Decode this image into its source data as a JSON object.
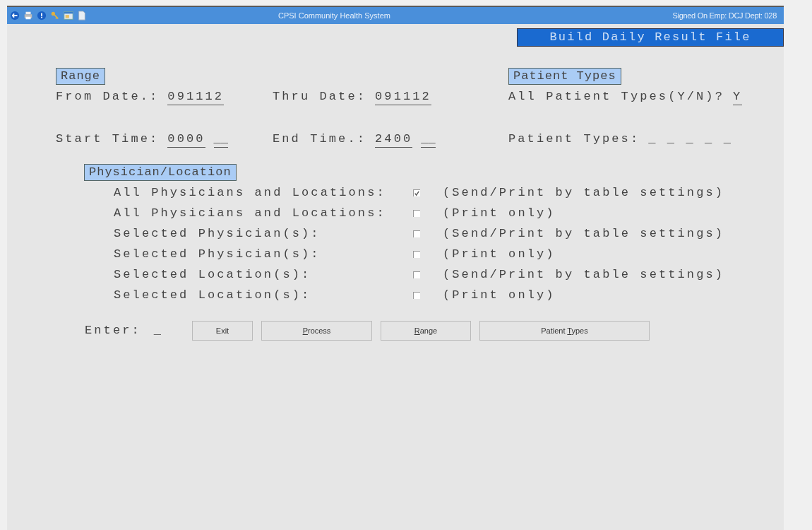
{
  "title_bar": {
    "title": "CPSI Community Health System",
    "user": "Signed On Emp: DCJ  Dept: 028"
  },
  "screen_title": "Build Daily Result File",
  "range": {
    "heading": "Range",
    "from_date": {
      "label": "From Date.:",
      "value": "091112"
    },
    "thru_date": {
      "label": "Thru Date:",
      "value": "091112"
    },
    "start_time": {
      "label": "Start Time:",
      "value": "0000",
      "suffix": "__"
    },
    "end_time": {
      "label": "End Time.:",
      "value": "2400",
      "suffix": "__"
    }
  },
  "patient_types": {
    "heading": "Patient Types",
    "all": {
      "label": "All Patient Types(Y/N)?",
      "value": "Y"
    },
    "types": {
      "label": "Patient Types:",
      "value": "_ _ _ _ _"
    }
  },
  "physician_location": {
    "heading": "Physician/Location",
    "options": [
      {
        "label": "All Physicians and Locations:",
        "checked": true,
        "description": "(Send/Print by table settings)"
      },
      {
        "label": "All Physicians and Locations:",
        "checked": false,
        "description": "(Print only)"
      },
      {
        "label": "Selected Physician(s):",
        "checked": false,
        "description": "(Send/Print by table settings)"
      },
      {
        "label": "Selected Physician(s):",
        "checked": false,
        "description": "(Print only)"
      },
      {
        "label": "Selected Location(s):",
        "checked": false,
        "description": "(Send/Print by table settings)"
      },
      {
        "label": "Selected Location(s):",
        "checked": false,
        "description": "(Print only)"
      }
    ]
  },
  "enter": {
    "label": "Enter:",
    "value": "_"
  },
  "buttons": [
    {
      "label": "Exit"
    },
    {
      "key": "P",
      "label_after": "rocess"
    },
    {
      "key": "R",
      "label_after": "ange"
    },
    {
      "label": "Patient ",
      "key": "T",
      "label_after": "ypes"
    }
  ]
}
